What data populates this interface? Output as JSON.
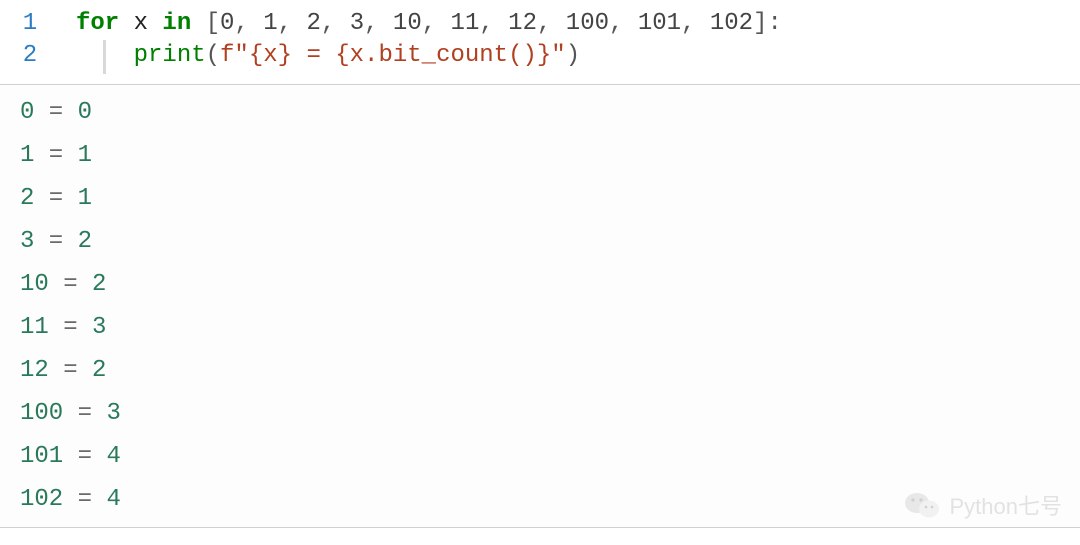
{
  "code": {
    "lines": [
      {
        "lineno": "1",
        "tokens": [
          {
            "t": "for ",
            "c": "kw"
          },
          {
            "t": "x ",
            "c": "plain"
          },
          {
            "t": "in ",
            "c": "kw"
          },
          {
            "t": "[",
            "c": "punct"
          },
          {
            "t": "0",
            "c": "num"
          },
          {
            "t": ", ",
            "c": "punct"
          },
          {
            "t": "1",
            "c": "num"
          },
          {
            "t": ", ",
            "c": "punct"
          },
          {
            "t": "2",
            "c": "num"
          },
          {
            "t": ", ",
            "c": "punct"
          },
          {
            "t": "3",
            "c": "num"
          },
          {
            "t": ", ",
            "c": "punct"
          },
          {
            "t": "10",
            "c": "num"
          },
          {
            "t": ", ",
            "c": "punct"
          },
          {
            "t": "11",
            "c": "num"
          },
          {
            "t": ", ",
            "c": "punct"
          },
          {
            "t": "12",
            "c": "num"
          },
          {
            "t": ", ",
            "c": "punct"
          },
          {
            "t": "100",
            "c": "num"
          },
          {
            "t": ", ",
            "c": "punct"
          },
          {
            "t": "101",
            "c": "num"
          },
          {
            "t": ", ",
            "c": "punct"
          },
          {
            "t": "102",
            "c": "num"
          },
          {
            "t": "]:",
            "c": "punct"
          }
        ]
      },
      {
        "lineno": "2",
        "tokens": [
          {
            "t": "    ",
            "c": "plain"
          },
          {
            "t": "print",
            "c": "builtin"
          },
          {
            "t": "(",
            "c": "punct"
          },
          {
            "t": "f\"{x} = {x.bit_count()}\"",
            "c": "fstr"
          },
          {
            "t": ")",
            "c": "punct"
          }
        ]
      }
    ]
  },
  "output": [
    {
      "n": "0",
      "v": "0"
    },
    {
      "n": "1",
      "v": "1"
    },
    {
      "n": "2",
      "v": "1"
    },
    {
      "n": "3",
      "v": "2"
    },
    {
      "n": "10",
      "v": "2"
    },
    {
      "n": "11",
      "v": "3"
    },
    {
      "n": "12",
      "v": "2"
    },
    {
      "n": "100",
      "v": "3"
    },
    {
      "n": "101",
      "v": "4"
    },
    {
      "n": "102",
      "v": "4"
    }
  ],
  "output_sep": " = ",
  "watermark": {
    "text": "Python七号"
  }
}
